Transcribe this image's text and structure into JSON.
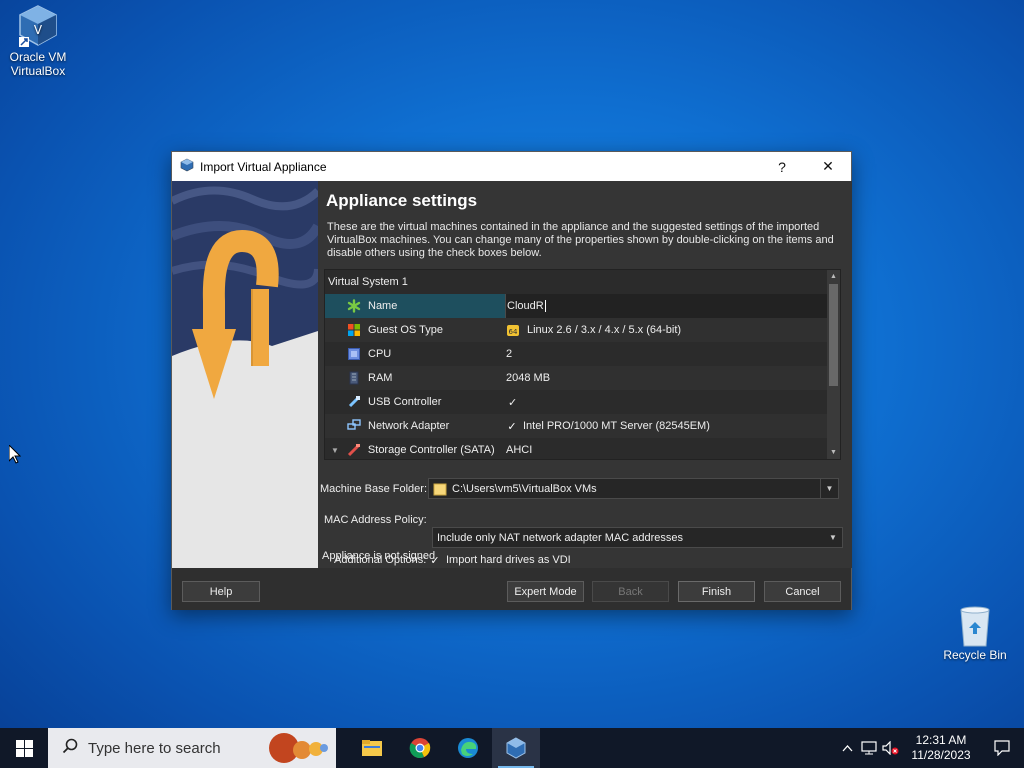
{
  "desktop": {
    "icons": [
      {
        "label": "Oracle VM VirtualBox"
      },
      {
        "label": "Recycle Bin"
      }
    ]
  },
  "dialog": {
    "title": "Import Virtual Appliance",
    "help_glyph": "?",
    "close_glyph": "✕",
    "heading": "Appliance settings",
    "description": "These are the virtual machines contained in the appliance and the suggested settings of the imported VirtualBox machines. You can change many of the properties shown by double-clicking on the items and disable others using the check boxes below.",
    "tree": {
      "group": "Virtual System 1",
      "rows": [
        {
          "key": "Name",
          "value": "CloudR",
          "icon": "name-star-icon"
        },
        {
          "key": "Guest OS Type",
          "value": "Linux 2.6 / 3.x / 4.x / 5.x (64-bit)",
          "icon": "os-type-icon"
        },
        {
          "key": "CPU",
          "value": "2",
          "icon": "cpu-icon"
        },
        {
          "key": "RAM",
          "value": "2048 MB",
          "icon": "ram-icon"
        },
        {
          "key": "USB Controller",
          "value": "✓",
          "icon": "usb-icon"
        },
        {
          "key": "Network Adapter",
          "value": "Intel PRO/1000 MT Server (82545EM)",
          "icon": "network-icon"
        },
        {
          "key": "Storage Controller (SATA)",
          "value": "AHCI",
          "icon": "storage-icon"
        }
      ]
    },
    "machine_base_folder": {
      "label": "Machine Base Folder:",
      "value": "C:\\Users\\vm5\\VirtualBox VMs"
    },
    "mac_policy": {
      "label": "MAC Address Policy:",
      "value": "Include only NAT network adapter MAC addresses"
    },
    "additional_options": {
      "label": "Additional Options:",
      "checkbox_label": "Import hard drives as VDI",
      "checked": true
    },
    "signed_status": "Appliance is not signed",
    "buttons": {
      "help": "Help",
      "expert": "Expert Mode",
      "back": "Back",
      "finish": "Finish",
      "cancel": "Cancel"
    }
  },
  "taskbar": {
    "search_placeholder": "Type here to search",
    "clock_time": "12:31 AM",
    "clock_date": "11/28/2023"
  },
  "colors": {
    "accent": "#1e4f5e",
    "desktop": "#0f6fd1"
  }
}
